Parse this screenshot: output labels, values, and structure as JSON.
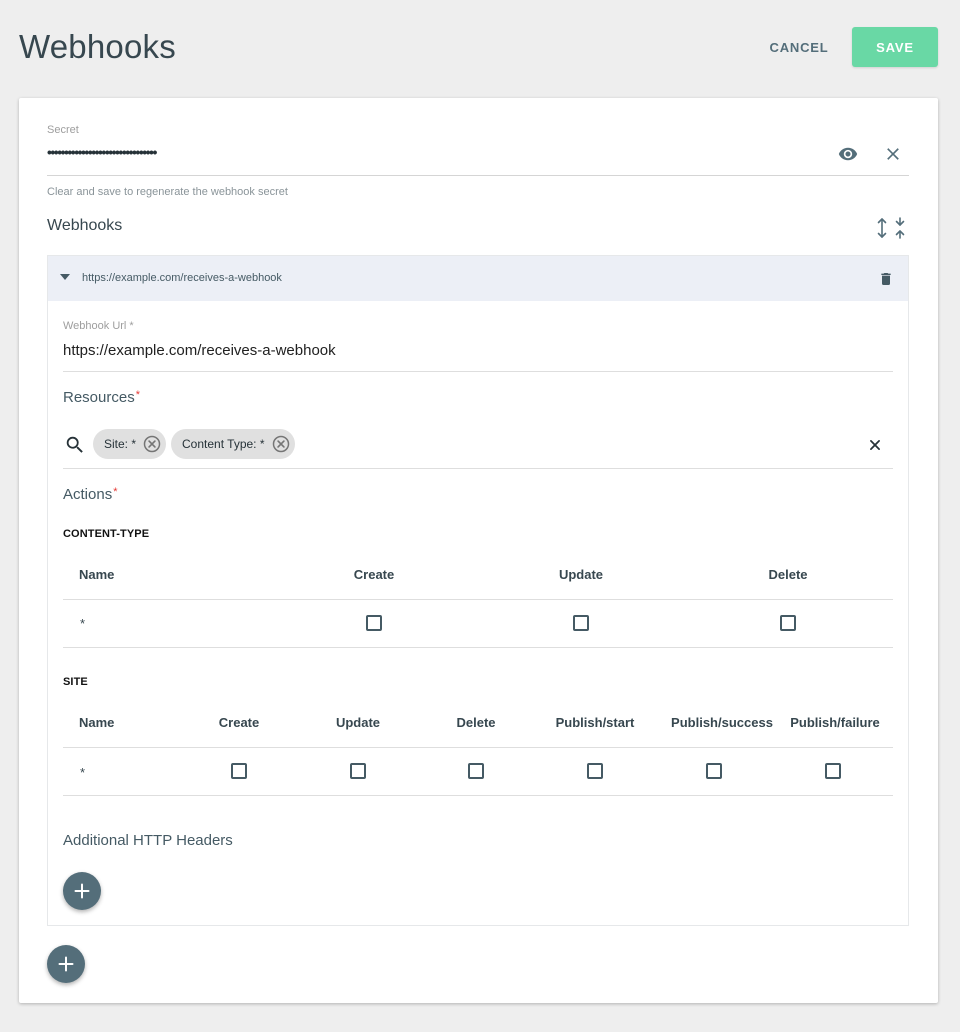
{
  "header": {
    "title": "Webhooks",
    "cancel_label": "CANCEL",
    "save_label": "SAVE"
  },
  "secret": {
    "label": "Secret",
    "value": "••••••••••••••••••••••••••••••••",
    "help": "Clear and save to regenerate the webhook secret"
  },
  "webhooks_section": {
    "title": "Webhooks"
  },
  "webhook": {
    "header_url": "https://example.com/receives-a-webhook",
    "url_label": "Webhook Url *",
    "url_value": "https://example.com/receives-a-webhook",
    "resources_label": "Resources",
    "required_marker": "*",
    "chips": [
      {
        "label": "Site: *"
      },
      {
        "label": "Content Type: *"
      }
    ],
    "actions_label": "Actions",
    "groups": [
      {
        "label": "CONTENT-TYPE",
        "columns": [
          "Name",
          "Create",
          "Update",
          "Delete"
        ],
        "rows": [
          {
            "name": "*",
            "checked": [
              false,
              false,
              false
            ]
          }
        ]
      },
      {
        "label": "SITE",
        "columns": [
          "Name",
          "Create",
          "Update",
          "Delete",
          "Publish/start",
          "Publish/success",
          "Publish/failure"
        ],
        "rows": [
          {
            "name": "*",
            "checked": [
              false,
              false,
              false,
              false,
              false,
              false
            ]
          }
        ]
      }
    ],
    "headers_label": "Additional HTTP Headers"
  },
  "icons": {
    "eye": "eye-icon",
    "clear": "close-icon",
    "expand_collapse": "expand-collapse-icon",
    "caret": "caret-down-icon",
    "trash": "trash-icon",
    "search": "search-icon",
    "chip_remove": "cancel-circle-icon",
    "add": "plus-icon"
  },
  "colors": {
    "save": "#69d8a5",
    "fab": "#546e7a",
    "panel_header": "#eceff6",
    "required": "#e53935"
  }
}
